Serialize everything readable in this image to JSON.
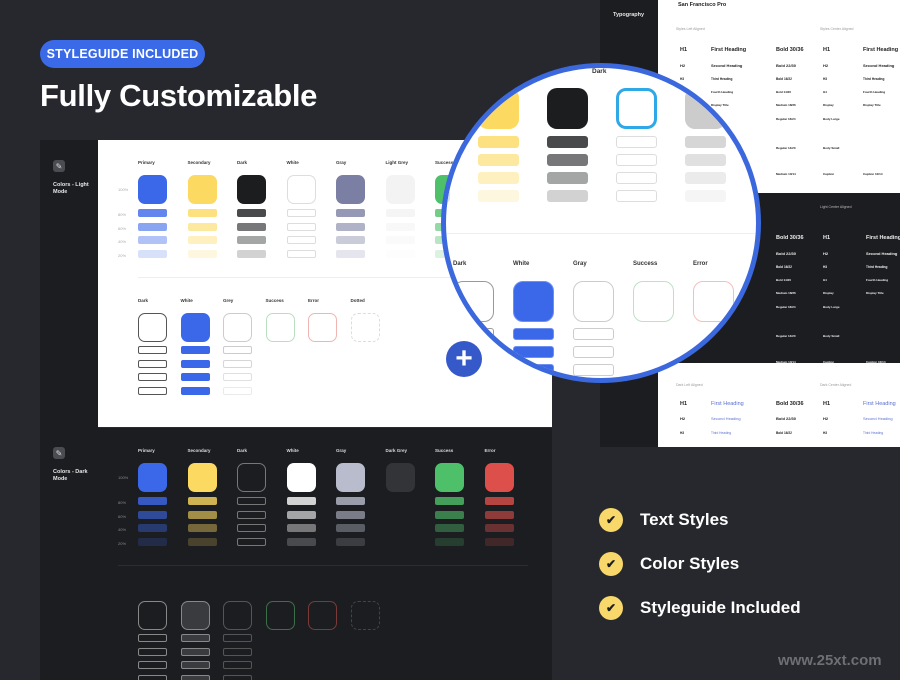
{
  "badge": "STYLEGUIDE INCLUDED",
  "headline": "Fully Customizable",
  "light_mode": {
    "section_label": "Colors - Light Mode",
    "section_icon": "paint-bucket-icon",
    "percent_labels": [
      "100%",
      "80%",
      "60%",
      "40%",
      "20%"
    ],
    "columns": [
      {
        "title": "Primary",
        "color": "#3b68e8"
      },
      {
        "title": "Secondary",
        "color": "#fcd960"
      },
      {
        "title": "Dark",
        "color": "#1c1d1f"
      },
      {
        "title": "White",
        "color": "#ffffff"
      },
      {
        "title": "Gray",
        "color": "#7b7fa3"
      },
      {
        "title": "Light Grey",
        "color": "#f3f3f4"
      },
      {
        "title": "Success",
        "color": "#4ec06a"
      }
    ],
    "outline_columns": [
      {
        "title": "Dark"
      },
      {
        "title": "White"
      },
      {
        "title": "Grey"
      },
      {
        "title": "Success"
      },
      {
        "title": "Error"
      },
      {
        "title": "Dotted"
      }
    ]
  },
  "dark_mode": {
    "section_label": "Colors - Dark Mode",
    "section_icon": "paint-bucket-icon",
    "percent_labels": [
      "100%",
      "80%",
      "60%",
      "40%",
      "20%"
    ],
    "columns": [
      {
        "title": "Primary",
        "color": "#3b68e8"
      },
      {
        "title": "Secondary",
        "color": "#fcd960"
      },
      {
        "title": "Dark",
        "color": "#1c1d20"
      },
      {
        "title": "White",
        "color": "#ffffff"
      },
      {
        "title": "Gray",
        "color": "#b9bccc"
      },
      {
        "title": "Dark Grey",
        "color": "#333438"
      },
      {
        "title": "Success",
        "color": "#4ec06a"
      },
      {
        "title": "Error",
        "color": "#dc4f4b"
      }
    ]
  },
  "typography": {
    "section_label": "Typography",
    "font_name": "San Francisco Pro",
    "left_align_label": "Styles Left Aligned",
    "center_align_label": "Styles Center Aligned",
    "dark_center_label": "Light Center Aligned",
    "bottom_left_label": "Dark Left Aligned",
    "bottom_center_label": "Dark Center Aligned",
    "rows": [
      {
        "tag": "H1",
        "name": "First Heading",
        "spec": "Bold 30/36"
      },
      {
        "tag": "H2",
        "name": "Second Heading",
        "spec": "Bold 22/30"
      },
      {
        "tag": "H3",
        "name": "Third Heading",
        "spec": "Bold 16/22"
      },
      {
        "tag": "H4",
        "name": "Fourth Heading",
        "spec": "Bold 14/20"
      },
      {
        "tag": "Display",
        "name": "Display Title",
        "spec": "Medium 18/26"
      },
      {
        "tag": "Body Large",
        "name": "",
        "spec": "Regular 16/24"
      },
      {
        "tag": "Body Small",
        "name": "",
        "spec": "Regular 14/20"
      },
      {
        "tag": "Caption",
        "name": "Caption 10/14",
        "spec": "Medium 10/14"
      }
    ]
  },
  "magnifier": {
    "top_label": "Dark",
    "bottom_columns": [
      "Dark",
      "White",
      "Gray",
      "Success",
      "Error"
    ],
    "zoom_button": "+"
  },
  "features": [
    {
      "label": "Text Styles",
      "icon": "check-icon"
    },
    {
      "label": "Color Styles",
      "icon": "check-icon"
    },
    {
      "label": "Styleguide Included",
      "icon": "check-icon"
    }
  ],
  "watermark": "www.25xt.com"
}
